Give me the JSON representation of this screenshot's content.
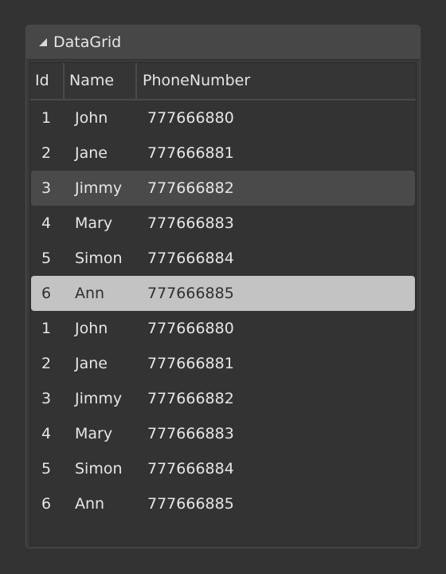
{
  "panel": {
    "title": "DataGrid",
    "collapse_icon": "triangle-collapse-icon"
  },
  "grid": {
    "columns": [
      "Id",
      "Name",
      "PhoneNumber"
    ],
    "rows": [
      {
        "id": "1",
        "name": "John",
        "phone": "777666880"
      },
      {
        "id": "2",
        "name": "Jane",
        "phone": "777666881"
      },
      {
        "id": "3",
        "name": "Jimmy",
        "phone": "777666882"
      },
      {
        "id": "4",
        "name": "Mary",
        "phone": "777666883"
      },
      {
        "id": "5",
        "name": "Simon",
        "phone": "777666884"
      },
      {
        "id": "6",
        "name": "Ann",
        "phone": "777666885"
      },
      {
        "id": "1",
        "name": "John",
        "phone": "777666880"
      },
      {
        "id": "2",
        "name": "Jane",
        "phone": "777666881"
      },
      {
        "id": "3",
        "name": "Jimmy",
        "phone": "777666882"
      },
      {
        "id": "4",
        "name": "Mary",
        "phone": "777666883"
      },
      {
        "id": "5",
        "name": "Simon",
        "phone": "777666884"
      },
      {
        "id": "6",
        "name": "Ann",
        "phone": "777666885"
      }
    ],
    "hover_row_index": 2,
    "selected_row_index": 5
  },
  "colors": {
    "background": "#333333",
    "header": "#474747",
    "row_hover": "#4a4a4a",
    "row_selected": "#c3c3c3"
  }
}
